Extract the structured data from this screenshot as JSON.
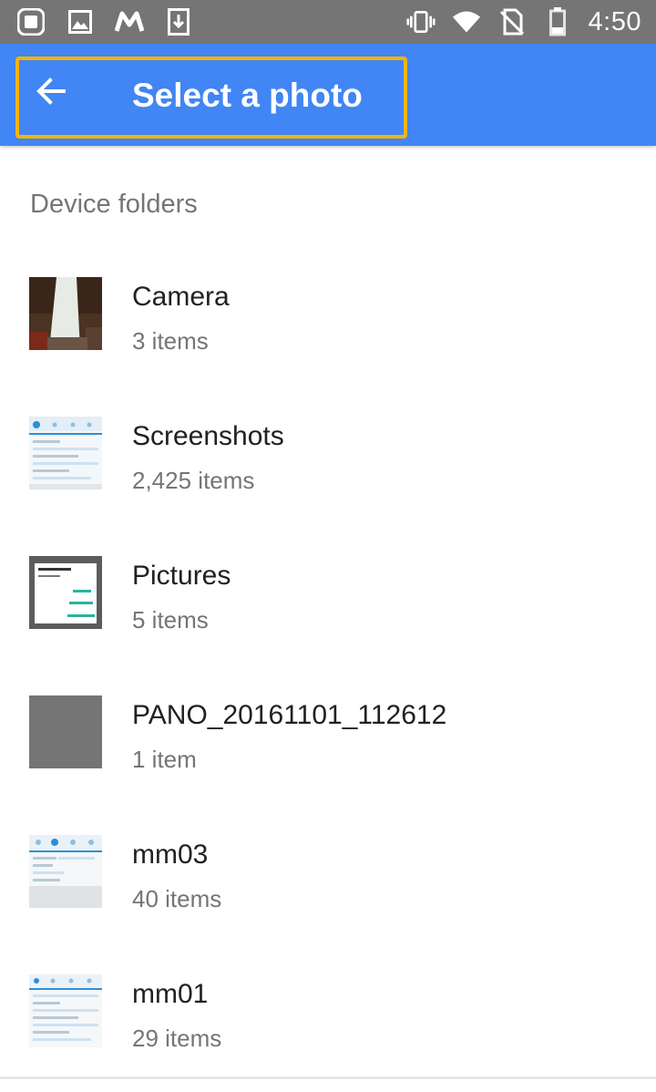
{
  "status_bar": {
    "time": "4:50",
    "left_icons": [
      "app-icon",
      "image-icon",
      "m-logo-icon",
      "download-icon"
    ],
    "right_icons": [
      "vibrate-icon",
      "wifi-icon",
      "no-sim-icon",
      "battery-icon"
    ]
  },
  "app_bar": {
    "title": "Select a photo",
    "back_icon": "arrow-back-icon",
    "color": "#4285f4",
    "highlight_color": "#f5b400"
  },
  "section": {
    "header": "Device folders"
  },
  "folders": [
    {
      "name": "Camera",
      "count": "3 items",
      "thumb": "camera-photo"
    },
    {
      "name": "Screenshots",
      "count": "2,425 items",
      "thumb": "screenshot"
    },
    {
      "name": "Pictures",
      "count": "5 items",
      "thumb": "dialog"
    },
    {
      "name": "PANO_20161101_112612",
      "count": "1 item",
      "thumb": "gray"
    },
    {
      "name": "mm03",
      "count": "40 items",
      "thumb": "screenshot"
    },
    {
      "name": "mm01",
      "count": "29 items",
      "thumb": "screenshot"
    }
  ]
}
